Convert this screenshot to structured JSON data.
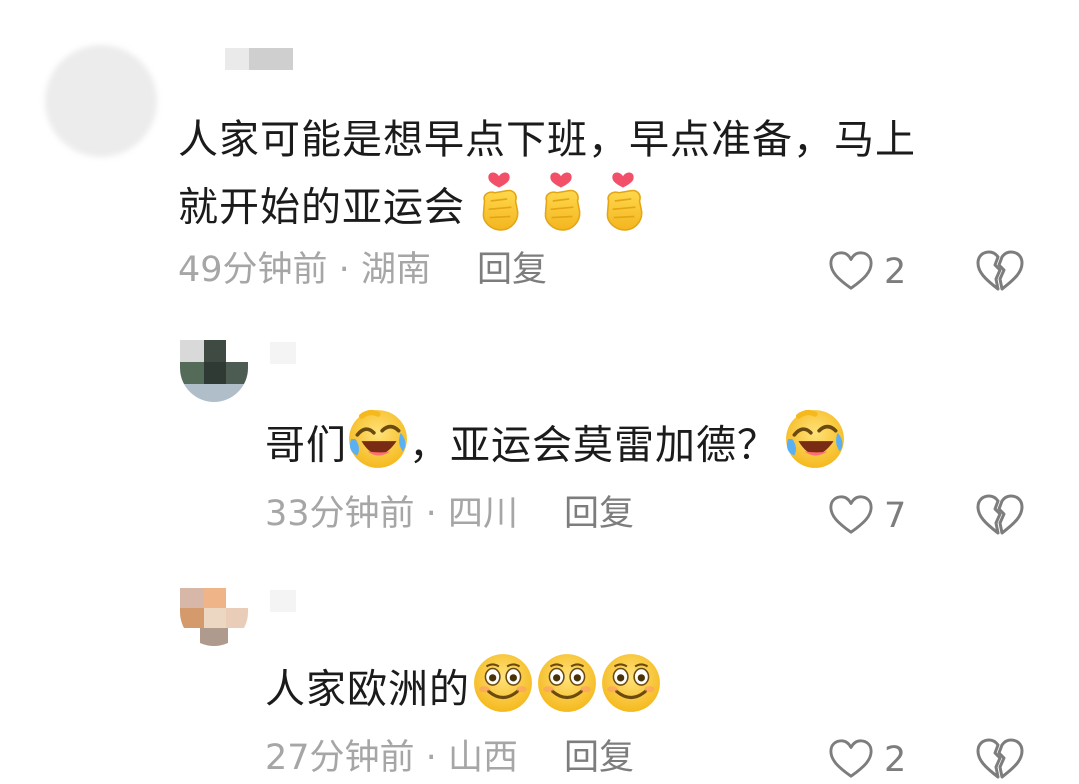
{
  "comments": [
    {
      "text": "人家可能是想早点下班，早点准备，马上",
      "text_line2": "就开始的亚运会",
      "emoji": [
        "finger-heart-icon",
        "finger-heart-icon",
        "finger-heart-icon"
      ],
      "time": "49分钟前",
      "location": "湖南",
      "reply_label": "回复",
      "likes": "2"
    },
    {
      "text_before": "哥们",
      "text_after": "，亚运会莫雷加德？",
      "emoji": [
        "rofl-icon",
        "rofl-icon"
      ],
      "time": "33分钟前",
      "location": "四川",
      "reply_label": "回复",
      "likes": "7"
    },
    {
      "text": "人家欧洲的",
      "emoji": [
        "smile-icon",
        "smile-icon",
        "smile-icon"
      ],
      "time": "27分钟前",
      "location": "山西",
      "reply_label": "回复",
      "likes": "2"
    }
  ],
  "separator": " · ",
  "colors": {
    "text": "#1b1b1b",
    "meta": "#a6a6a6",
    "reply": "#7d7d7d",
    "emoji_yellow": "#f7c531",
    "heart_pink": "#f25068"
  }
}
